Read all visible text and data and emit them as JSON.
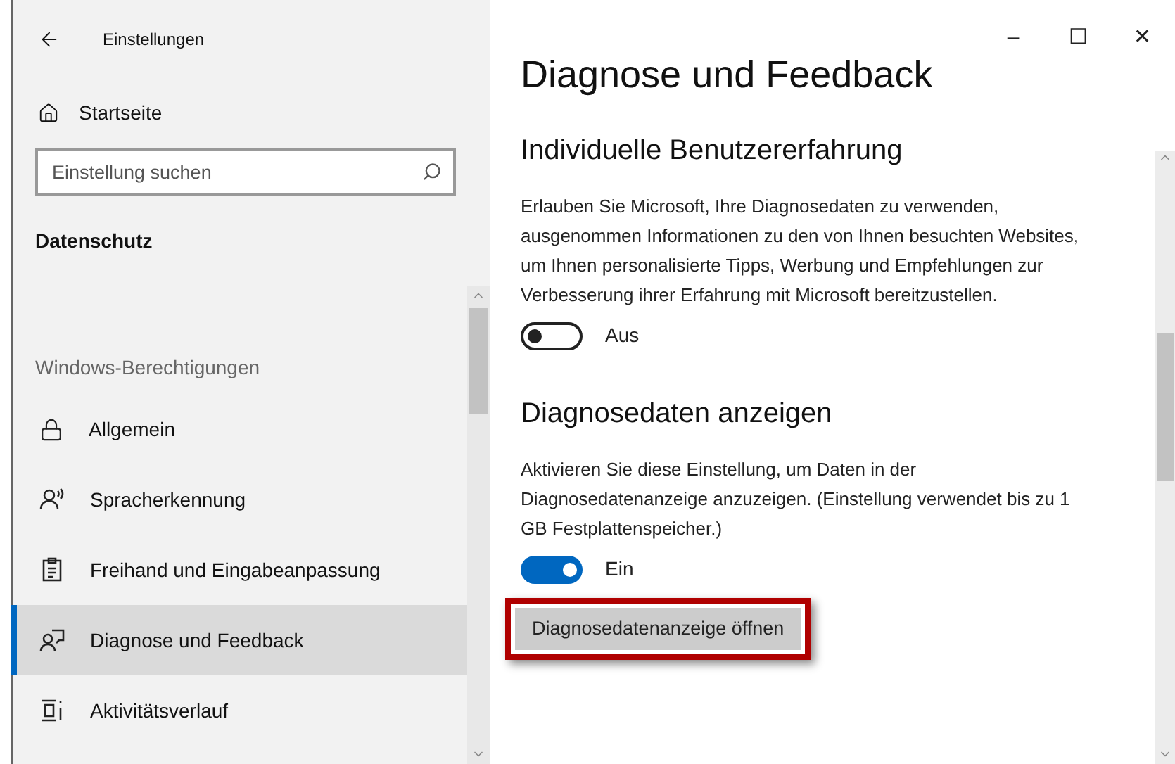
{
  "window": {
    "title": "Einstellungen",
    "controls": [
      "–",
      "☐",
      "✕"
    ]
  },
  "sidebar": {
    "home": "Startseite",
    "search": {
      "placeholder": "Einstellung suchen"
    },
    "category": "Datenschutz",
    "group": "Windows-Berechtigungen",
    "items": [
      {
        "label": "Allgemein",
        "selected": false
      },
      {
        "label": "Spracherkennung",
        "selected": false
      },
      {
        "label": "Freihand  und Eingabeanpassung",
        "selected": false
      },
      {
        "label": "Diagnose und Feedback",
        "selected": true
      },
      {
        "label": "Aktivitätsverlauf",
        "selected": false
      }
    ]
  },
  "page": {
    "title": "Diagnose und Feedback",
    "sections": [
      {
        "heading": "Individuelle Benutzererfahrung",
        "text": "Erlauben Sie Microsoft, Ihre Diagnosedaten zu verwenden, ausgenommen Informationen zu den von Ihnen besuchten Websites, um Ihnen personalisierte Tipps, Werbung und Empfehlungen zur Verbesserung ihrer Erfahrung mit Microsoft bereitzustellen.",
        "toggle": {
          "on": false,
          "label": "Aus"
        }
      },
      {
        "heading": "Diagnosedaten anzeigen",
        "text": "Aktivieren Sie diese Einstellung, um Daten in der Diagnosedatenanzeige anzuzeigen. (Einstellung verwendet bis zu 1 GB Festplattenspeicher.)",
        "toggle": {
          "on": true,
          "label": "Ein"
        },
        "button": {
          "label": "Diagnosedatenanzeige öffnen",
          "highlighted": true
        }
      }
    ]
  }
}
